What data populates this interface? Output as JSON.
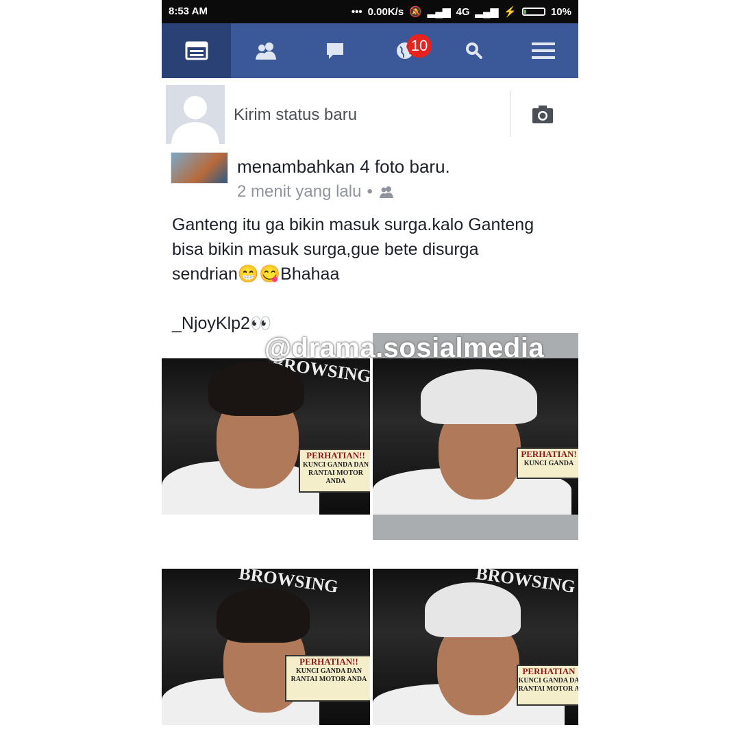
{
  "status_bar": {
    "time": "8:53 AM",
    "network_speed": "0.00K/s",
    "network_type": "4G",
    "battery": "10%"
  },
  "nav": {
    "tabs": [
      {
        "name": "news-feed",
        "icon": "news-feed-icon",
        "active": true
      },
      {
        "name": "friend-requests",
        "icon": "friends-icon",
        "active": false
      },
      {
        "name": "messages",
        "icon": "chat-icon",
        "active": false
      },
      {
        "name": "notifications",
        "icon": "globe-icon",
        "active": false,
        "badge": "10"
      },
      {
        "name": "search",
        "icon": "search-icon",
        "active": false
      },
      {
        "name": "more",
        "icon": "menu-icon",
        "active": false
      }
    ],
    "colors": {
      "bar": "#3b5898",
      "active": "#2a4176",
      "badge": "#e8231f"
    }
  },
  "composer": {
    "placeholder": "Kirim status baru"
  },
  "post": {
    "action": "menambahkan 4 foto baru.",
    "time": "2 menit yang lalu",
    "privacy_icon": "friends-icon",
    "text_lines": [
      "Ganteng itu ga bikin masuk surga.kalo Ganteng",
      "bisa bikin masuk surga,gue bete disurga",
      "sendrian😁😋Bhahaa"
    ],
    "signature": "_NjoyKlp2👀",
    "photos": [
      {
        "sign_title": "PERHATIAN!!",
        "sign_text": "KUNCI GANDA DAN RANTAI MOTOR ANDA"
      },
      {
        "sign_title": "PERHATIAN!",
        "sign_text": "KUNCI GANDA"
      },
      {
        "sign_title": "PERHATIAN!!",
        "sign_text": "KUNCI GANDA DAN RANTAI MOTOR ANDA"
      },
      {
        "sign_title": "PERHATIAN",
        "sign_text": "KUNCI GANDA DA RANTAI MOTOR A"
      }
    ],
    "photo_background_text": "BROWSING"
  },
  "watermark": "@drama.sosialmedia"
}
